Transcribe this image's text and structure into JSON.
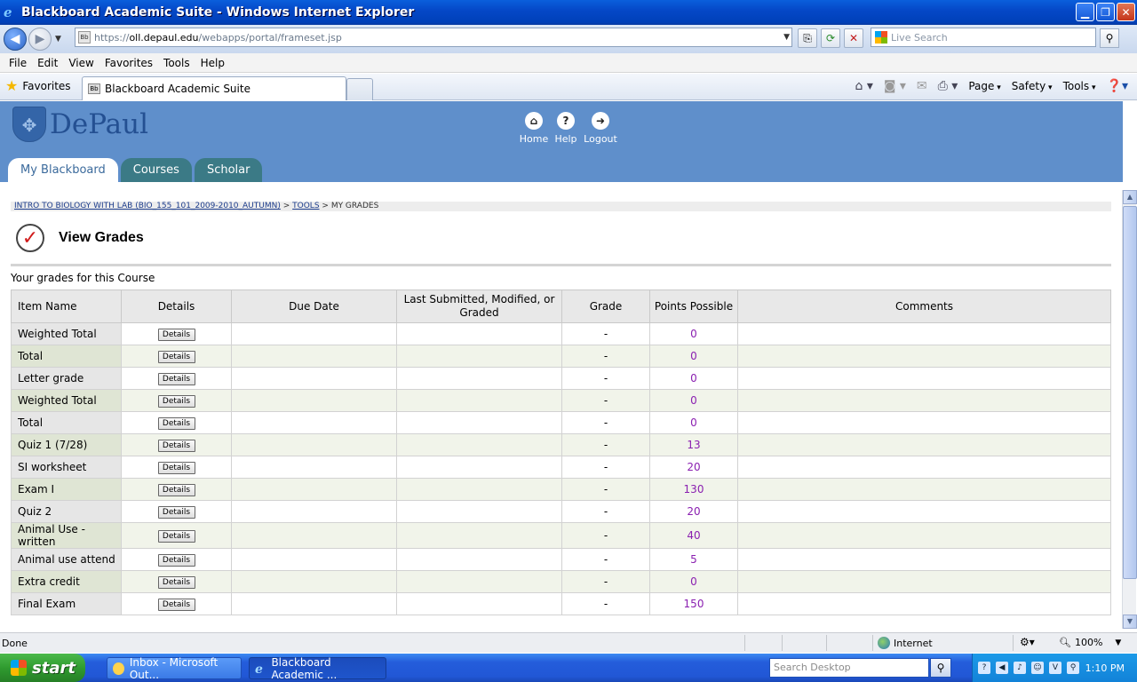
{
  "window": {
    "title": "Blackboard Academic Suite - Windows Internet Explorer",
    "minimize": "▁",
    "restore": "❐",
    "close": "✕"
  },
  "address": {
    "url_prefix": "https://",
    "url_domain": "oll.depaul.edu",
    "url_path": "/webapps/portal/frameset.jsp",
    "live_search_placeholder": "Live Search"
  },
  "menu": [
    "File",
    "Edit",
    "View",
    "Favorites",
    "Tools",
    "Help"
  ],
  "favorites": {
    "label": "Favorites",
    "tab_title": "Blackboard Academic Suite"
  },
  "commandbar": {
    "page": "Page",
    "safety": "Safety",
    "tools": "Tools"
  },
  "blackboard": {
    "logo_text": "DePaul",
    "top_links": {
      "home": "Home",
      "help": "Help",
      "logout": "Logout"
    },
    "tabs": [
      "My Blackboard",
      "Courses",
      "Scholar"
    ],
    "breadcrumb": {
      "course": "INTRO TO BIOLOGY WITH LAB (BIO_155_101_2009-2010_AUTUMN)",
      "sep1": " > ",
      "tools": "TOOLS",
      "sep2": " > ",
      "current": "MY GRADES"
    },
    "page_title": "View Grades",
    "subtitle": "Your grades for this Course",
    "table": {
      "headers": {
        "item_name": "Item Name",
        "details": "Details",
        "due_date": "Due Date",
        "last_submitted": "Last Submitted, Modified, or Graded",
        "grade": "Grade",
        "points_possible": "Points Possible",
        "comments": "Comments"
      },
      "details_button": "Details",
      "rows": [
        {
          "item": "Weighted Total",
          "due": "",
          "last": "",
          "grade": "-",
          "points": "0",
          "comments": ""
        },
        {
          "item": "Total",
          "due": "",
          "last": "",
          "grade": "-",
          "points": "0",
          "comments": ""
        },
        {
          "item": "Letter grade",
          "due": "",
          "last": "",
          "grade": "-",
          "points": "0",
          "comments": ""
        },
        {
          "item": "Weighted Total",
          "due": "",
          "last": "",
          "grade": "-",
          "points": "0",
          "comments": ""
        },
        {
          "item": "Total",
          "due": "",
          "last": "",
          "grade": "-",
          "points": "0",
          "comments": ""
        },
        {
          "item": "Quiz 1 (7/28)",
          "due": "",
          "last": "",
          "grade": "-",
          "points": "13",
          "comments": ""
        },
        {
          "item": "SI worksheet",
          "due": "",
          "last": "",
          "grade": "-",
          "points": "20",
          "comments": ""
        },
        {
          "item": "Exam I",
          "due": "",
          "last": "",
          "grade": "-",
          "points": "130",
          "comments": ""
        },
        {
          "item": "Quiz 2",
          "due": "",
          "last": "",
          "grade": "-",
          "points": "20",
          "comments": ""
        },
        {
          "item": "Animal Use -written",
          "due": "",
          "last": "",
          "grade": "-",
          "points": "40",
          "comments": ""
        },
        {
          "item": "Animal use attend",
          "due": "",
          "last": "",
          "grade": "-",
          "points": "5",
          "comments": ""
        },
        {
          "item": "Extra credit",
          "due": "",
          "last": "",
          "grade": "-",
          "points": "0",
          "comments": ""
        },
        {
          "item": "Final Exam",
          "due": "",
          "last": "",
          "grade": "-",
          "points": "150",
          "comments": ""
        }
      ]
    }
  },
  "status": {
    "text": "Done",
    "zone": "Internet",
    "zoom": "100%"
  },
  "taskbar": {
    "start": "start",
    "buttons": [
      "Inbox - Microsoft Out...",
      "Blackboard Academic ..."
    ],
    "search_placeholder": "Search Desktop",
    "clock": "1:10 PM"
  },
  "colors": {
    "header_blue": "#5f8fcb",
    "tab_teal": "#3b7a86",
    "points_purple": "#8a1fb0"
  }
}
